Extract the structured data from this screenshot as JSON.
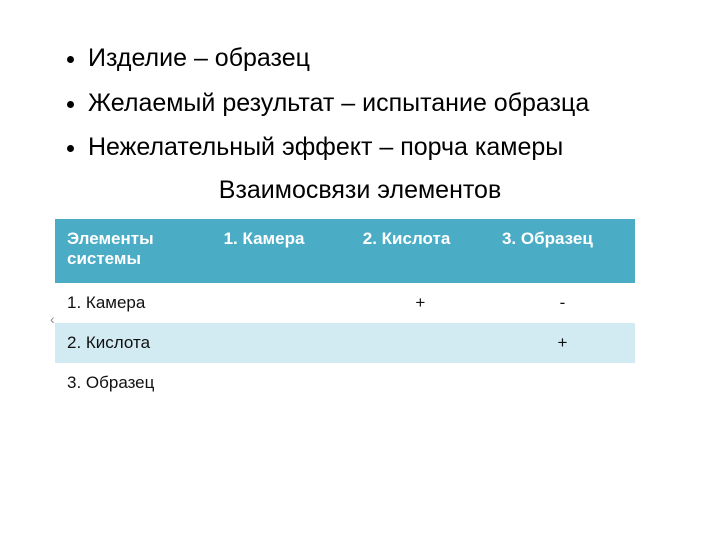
{
  "bullets": [
    "Изделие – образец",
    "Желаемый результат – испытание образца",
    "Нежелательный эффект – порча камеры"
  ],
  "subtitle": "Взаимосвязи элементов",
  "chevron": "‹",
  "table": {
    "headers": [
      "Элементы системы",
      "1. Камера",
      "2. Кислота",
      "3. Образец"
    ],
    "rows": [
      {
        "label": "Камера",
        "prefix": "1.",
        "cells": [
          "",
          "+",
          "-"
        ]
      },
      {
        "label": "2. Кислота",
        "prefix": "",
        "cells": [
          "",
          "",
          "+"
        ]
      },
      {
        "label": "3. Образец",
        "prefix": "",
        "cells": [
          "",
          "",
          ""
        ]
      }
    ]
  },
  "chart_data": {
    "type": "table",
    "title": "Взаимосвязи элементов",
    "columns": [
      "Элементы системы",
      "1. Камера",
      "2. Кислота",
      "3. Образец"
    ],
    "rows": [
      [
        "1. Камера",
        "",
        "+",
        "-"
      ],
      [
        "2. Кислота",
        "",
        "",
        "+"
      ],
      [
        "3. Образец",
        "",
        "",
        ""
      ]
    ]
  }
}
